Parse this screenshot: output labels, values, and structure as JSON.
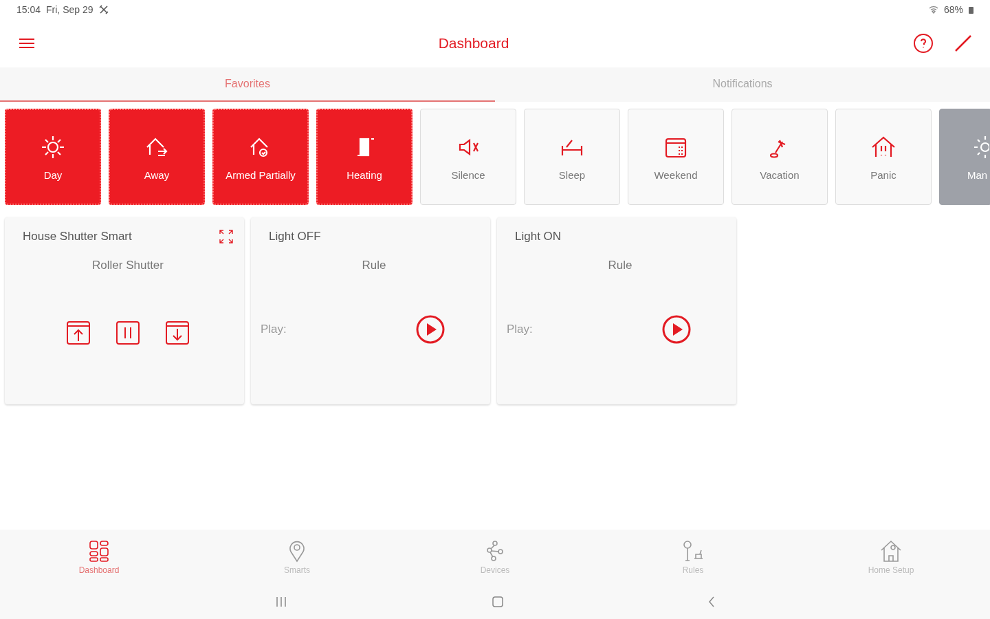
{
  "status_bar": {
    "time": "15:04",
    "date": "Fri, Sep 29",
    "battery": "68%"
  },
  "header": {
    "title": "Dashboard"
  },
  "tabs": [
    {
      "label": "Favorites",
      "selected": true
    },
    {
      "label": "Notifications",
      "selected": false
    }
  ],
  "scenes": [
    {
      "label": "Day",
      "active": true
    },
    {
      "label": "Away",
      "active": true
    },
    {
      "label": "Armed Partially",
      "active": true
    },
    {
      "label": "Heating",
      "active": true
    },
    {
      "label": "Silence",
      "active": false
    },
    {
      "label": "Sleep",
      "active": false
    },
    {
      "label": "Weekend",
      "active": false
    },
    {
      "label": "Vacation",
      "active": false
    },
    {
      "label": "Panic",
      "active": false
    },
    {
      "label": "Man",
      "active": false,
      "kind": "cut"
    }
  ],
  "cards": [
    {
      "kind": "shutter",
      "title": "House Shutter Smart",
      "subtitle": "Roller Shutter"
    },
    {
      "kind": "rule",
      "title": "Light OFF",
      "subtitle": "Rule",
      "play_label": "Play:"
    },
    {
      "kind": "rule",
      "title": "Light ON",
      "subtitle": "Rule",
      "play_label": "Play:"
    }
  ],
  "bottom_nav": [
    {
      "label": "Dashboard",
      "selected": true
    },
    {
      "label": "Smarts",
      "selected": false
    },
    {
      "label": "Devices",
      "selected": false
    },
    {
      "label": "Rules",
      "selected": false
    },
    {
      "label": "Home Setup",
      "selected": false
    }
  ]
}
